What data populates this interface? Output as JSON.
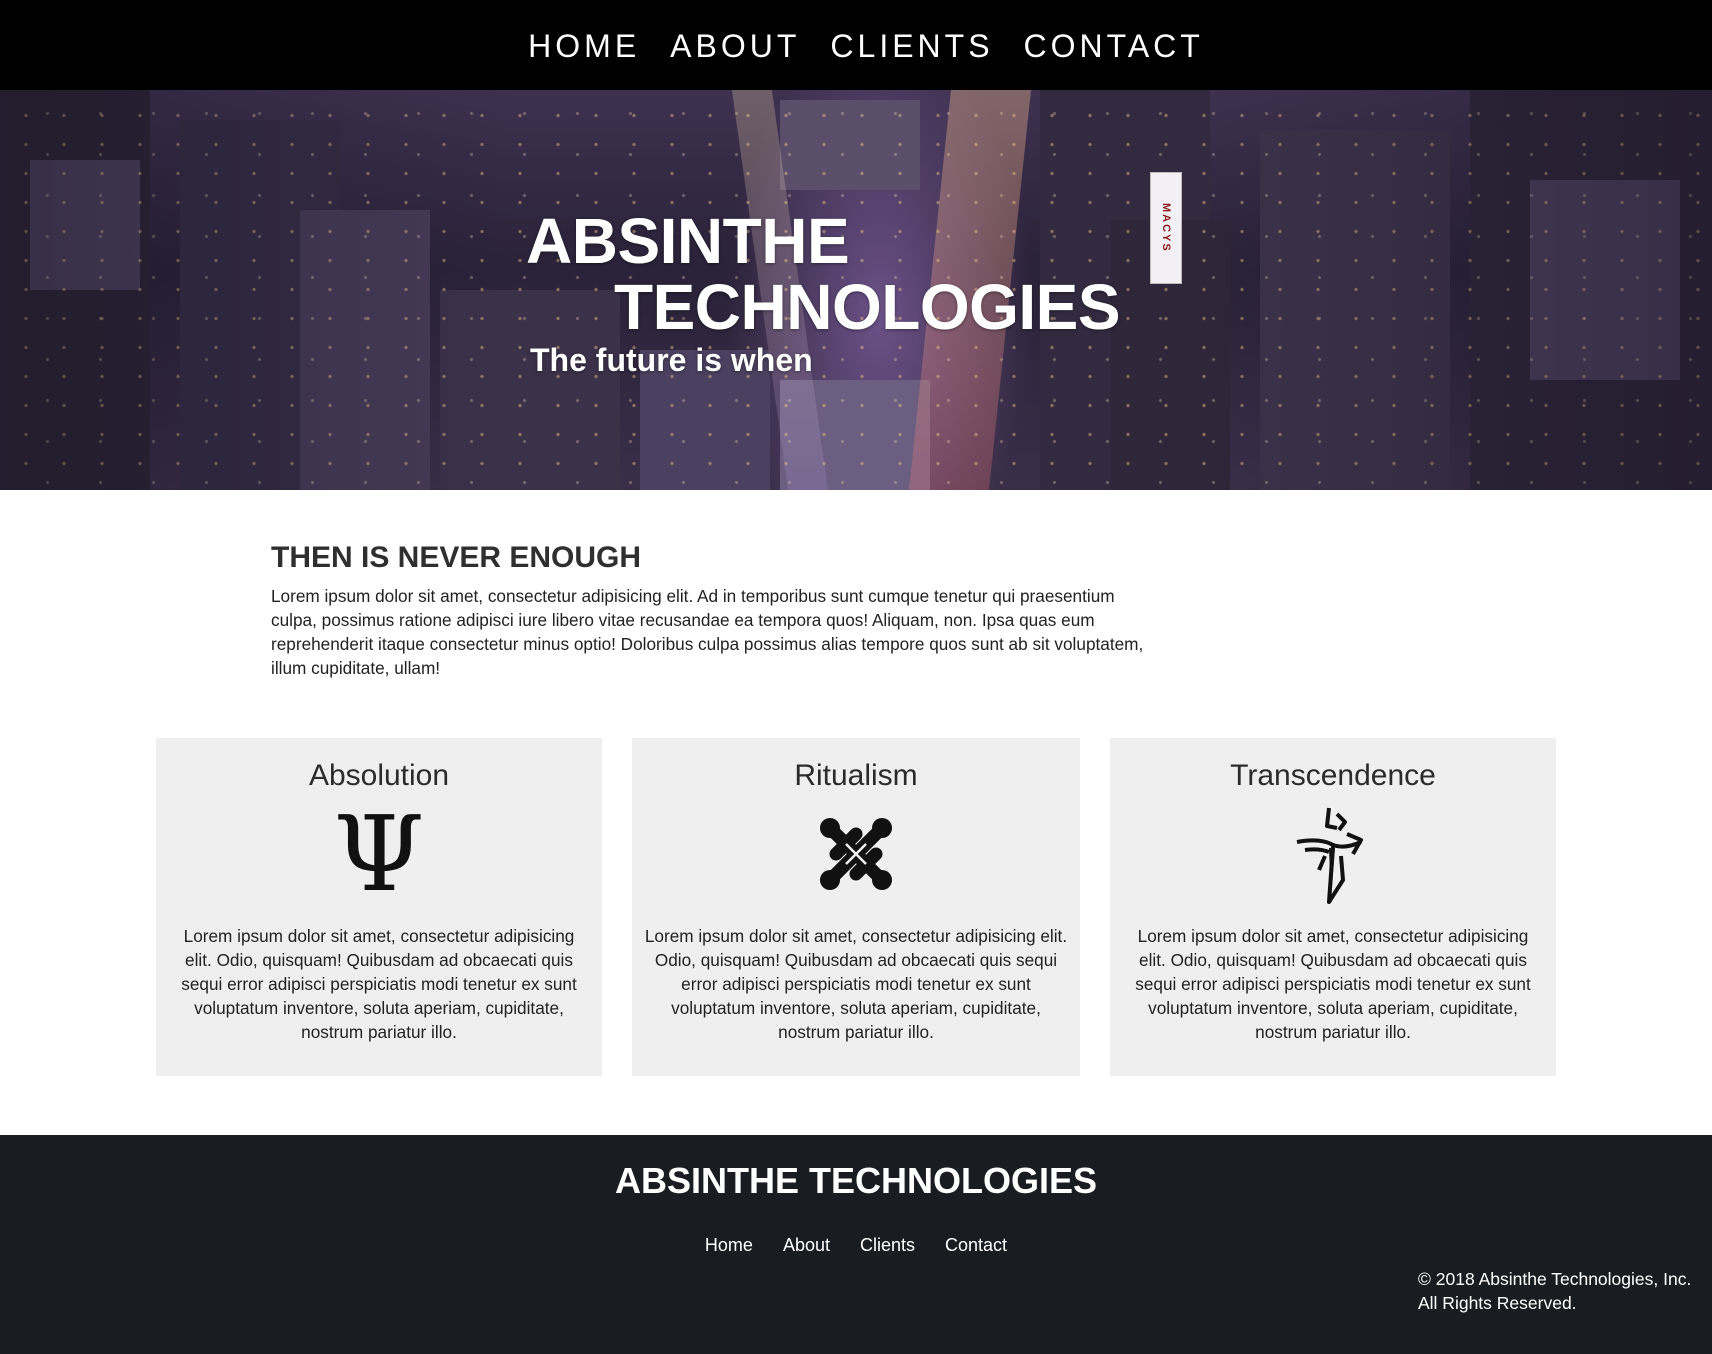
{
  "nav": {
    "items": [
      {
        "label": "HOME"
      },
      {
        "label": "ABOUT"
      },
      {
        "label": "CLIENTS"
      },
      {
        "label": "CONTACT"
      }
    ]
  },
  "hero": {
    "title_line1": "ABSINTHE",
    "title_line2": "TECHNOLOGIES",
    "tagline": "The future is when",
    "sign_text": "MACYS"
  },
  "intro": {
    "heading": "THEN IS NEVER ENOUGH",
    "body": "Lorem ipsum dolor sit amet, consectetur adipisicing elit. Ad in temporibus sunt cumque tenetur qui praesentium culpa, possimus ratione adipisci iure libero vitae recusandae ea tempora quos! Aliquam, non. Ipsa quas eum reprehenderit itaque consectetur minus optio! Doloribus culpa possimus alias tempore quos sunt ab sit voluptatem, illum cupiditate, ullam!"
  },
  "cards": [
    {
      "title": "Absolution",
      "icon": "psi-icon",
      "body": "Lorem ipsum dolor sit amet, consectetur adipisicing elit. Odio, quisquam! Quibusdam ad obcaecati quis sequi error adipisci perspiciatis modi tenetur ex sunt voluptatum inventore, soluta aperiam, cupiditate, nostrum pariatur illo."
    },
    {
      "title": "Ritualism",
      "icon": "joomla-icon",
      "body": "Lorem ipsum dolor sit amet, consectetur adipisicing elit. Odio, quisquam! Quibusdam ad obcaecati quis sequi error adipisci perspiciatis modi tenetur ex sunt voluptatum inventore, soluta aperiam, cupiditate, nostrum pariatur illo."
    },
    {
      "title": "Transcendence",
      "icon": "enlightened-icon",
      "body": "Lorem ipsum dolor sit amet, consectetur adipisicing elit. Odio, quisquam! Quibusdam ad obcaecati quis sequi error adipisci perspiciatis modi tenetur ex sunt voluptatum inventore, soluta aperiam, cupiditate, nostrum pariatur illo."
    }
  ],
  "footer": {
    "brand": "ABSINTHE TECHNOLOGIES",
    "links": [
      {
        "label": "Home"
      },
      {
        "label": "About"
      },
      {
        "label": "Clients"
      },
      {
        "label": "Contact"
      }
    ],
    "copyright_line1": "© 2018 Absinthe Technologies, Inc.",
    "copyright_line2": "All Rights Reserved."
  },
  "colors": {
    "nav_bg": "#000000",
    "footer_bg": "#191c21",
    "card_bg": "#efefef",
    "hero_tint": "#3e3150"
  }
}
